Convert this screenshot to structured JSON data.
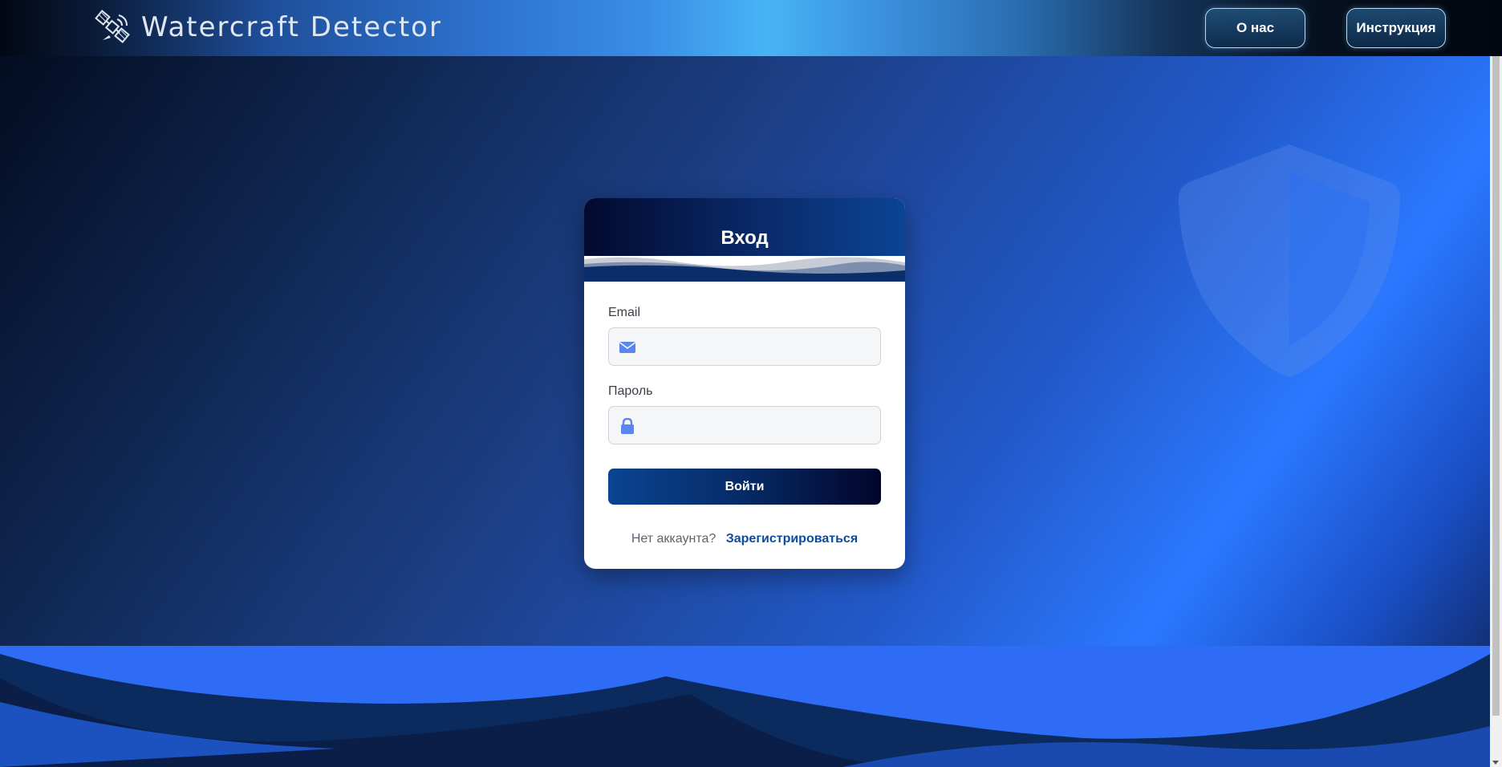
{
  "header": {
    "app_title": "Watercraft Detector",
    "logo_icon": "satellite-icon",
    "nav": {
      "about_label": "О нас",
      "guide_label": "Инструкция"
    }
  },
  "login_card": {
    "title": "Вход",
    "email": {
      "label": "Email",
      "value": "",
      "icon": "envelope-icon"
    },
    "password": {
      "label": "Пароль",
      "value": "",
      "icon": "lock-icon"
    },
    "submit_label": "Войти",
    "signup_prompt": "Нет аккаунта?",
    "signup_link": "Зарегистрироваться"
  },
  "decor": {
    "watermark_icon": "shield-icon"
  },
  "colors": {
    "primary_dark": "#021033",
    "primary_blue": "#0a4c9e",
    "accent_blue": "#2b78ff",
    "icon_blue": "#5b86f0"
  }
}
